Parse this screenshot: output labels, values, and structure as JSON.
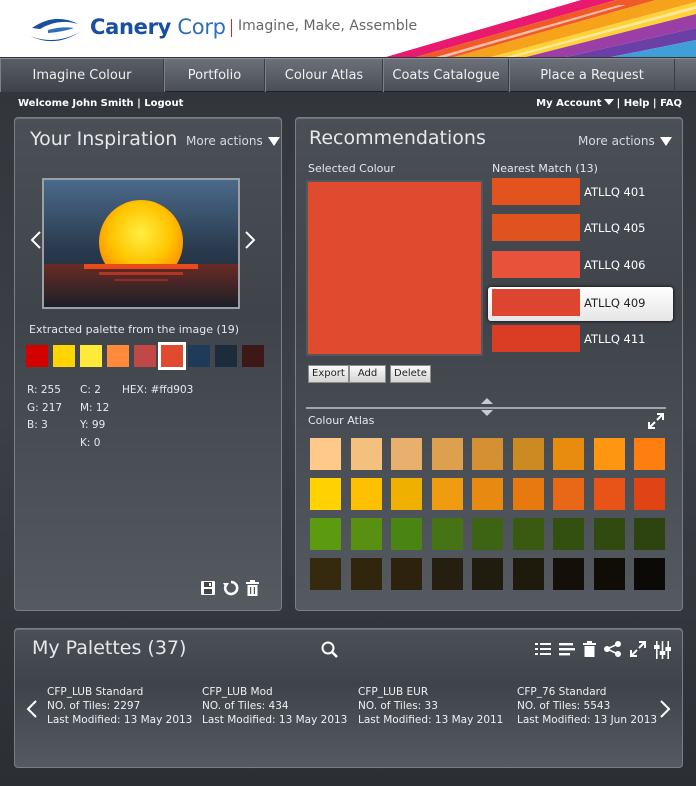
{
  "brand": {
    "name_bold": "Canery",
    "name_light": "Corp",
    "tagline": "Imagine, Make, Assemble"
  },
  "nav": {
    "items": [
      {
        "label": "Imagine Colour"
      },
      {
        "label": "Portfolio"
      },
      {
        "label": "Colour Atlas"
      },
      {
        "label": "Coats Catalogue"
      },
      {
        "label": "Place a Request"
      }
    ],
    "active_index": 0
  },
  "userbar": {
    "welcome": "Welcome John Smith | Logout",
    "my_account": "My Account",
    "help": "| Help |",
    "faq": "FAQ"
  },
  "inspiration": {
    "title": "Your Inspiration",
    "more_actions": "More actions",
    "palette_label": "Extracted palette from the image (19)",
    "palette": [
      "#d40000",
      "#ffd400",
      "#ffea3a",
      "#ff8a3c",
      "#c24848",
      "#e04a2e",
      "#1f3b5a",
      "#1b2c3d",
      "#3e1717"
    ],
    "selected_swatch": 5,
    "rgb": {
      "r": "R: 255",
      "g": "G: 217",
      "b": "B: 3"
    },
    "cmyk": {
      "c": "C: 2",
      "m": "M: 12",
      "y": "Y: 99",
      "k": "K: 0"
    },
    "hex": "HEX: #ffd903",
    "icons": [
      "save-icon",
      "refresh-icon",
      "trash-icon"
    ]
  },
  "recommendations": {
    "title": "Recommendations",
    "more_actions": "More actions",
    "selected_label": "Selected Colour",
    "selected_colour": "#e04a2e",
    "nearest_label": "Nearest Match (13)",
    "matches": [
      {
        "label": "ATLLQ 401",
        "color": "#e4521e"
      },
      {
        "label": "ATLLQ 405",
        "color": "#e0531f"
      },
      {
        "label": "ATLLQ 406",
        "color": "#e8523a"
      },
      {
        "label": "ATLLQ 409",
        "color": "#de4531",
        "selected": true
      },
      {
        "label": "ATLLQ 411",
        "color": "#db3d24"
      }
    ],
    "buttons": {
      "export": "Export",
      "add": "Add",
      "delete": "Delete"
    },
    "atlas_label": "Colour Atlas",
    "atlas_colors": [
      [
        "#ffc98a",
        "#f4c07e",
        "#e8b06c",
        "#dca04e",
        "#d49032",
        "#cc8a22",
        "#e88c10",
        "#ff9612",
        "#ff7e10"
      ],
      [
        "#ffd200",
        "#ffc000",
        "#f0b000",
        "#f09c10",
        "#e88a10",
        "#e87810",
        "#e86818",
        "#e85418",
        "#e04414"
      ],
      [
        "#5c9a10",
        "#5a9012",
        "#4a8412",
        "#467414",
        "#3d6412",
        "#3a5a12",
        "#345010",
        "#304a10",
        "#2e4410"
      ],
      [
        "#362a0e",
        "#30260e",
        "#2c220e",
        "#261e0e",
        "#201c0e",
        "#1e1a0c",
        "#140f08",
        "#100c06",
        "#0c0a06"
      ]
    ]
  },
  "my_palettes": {
    "title": "My Palettes (37)",
    "items": [
      {
        "name": "CFP_LUB Standard",
        "tiles": "NO. of Tiles: 2297",
        "modified": "Last Modified: 13 May 2013"
      },
      {
        "name": "CFP_LUB Mod",
        "tiles": "NO. of Tiles: 434",
        "modified": "Last Modified: 13 May 2013"
      },
      {
        "name": "CFP_LUB EUR",
        "tiles": "NO. of Tiles: 33",
        "modified": "Last Modified: 13 May 2011"
      },
      {
        "name": "CFP_76 Standard",
        "tiles": "NO. of Tiles: 5543",
        "modified": "Last Modified: 13 Jun 2013"
      }
    ],
    "icons": [
      "search-icon",
      "list-view-icon",
      "align-icon",
      "trash-icon",
      "share-icon",
      "expand-icon",
      "settings-sliders-icon"
    ]
  }
}
